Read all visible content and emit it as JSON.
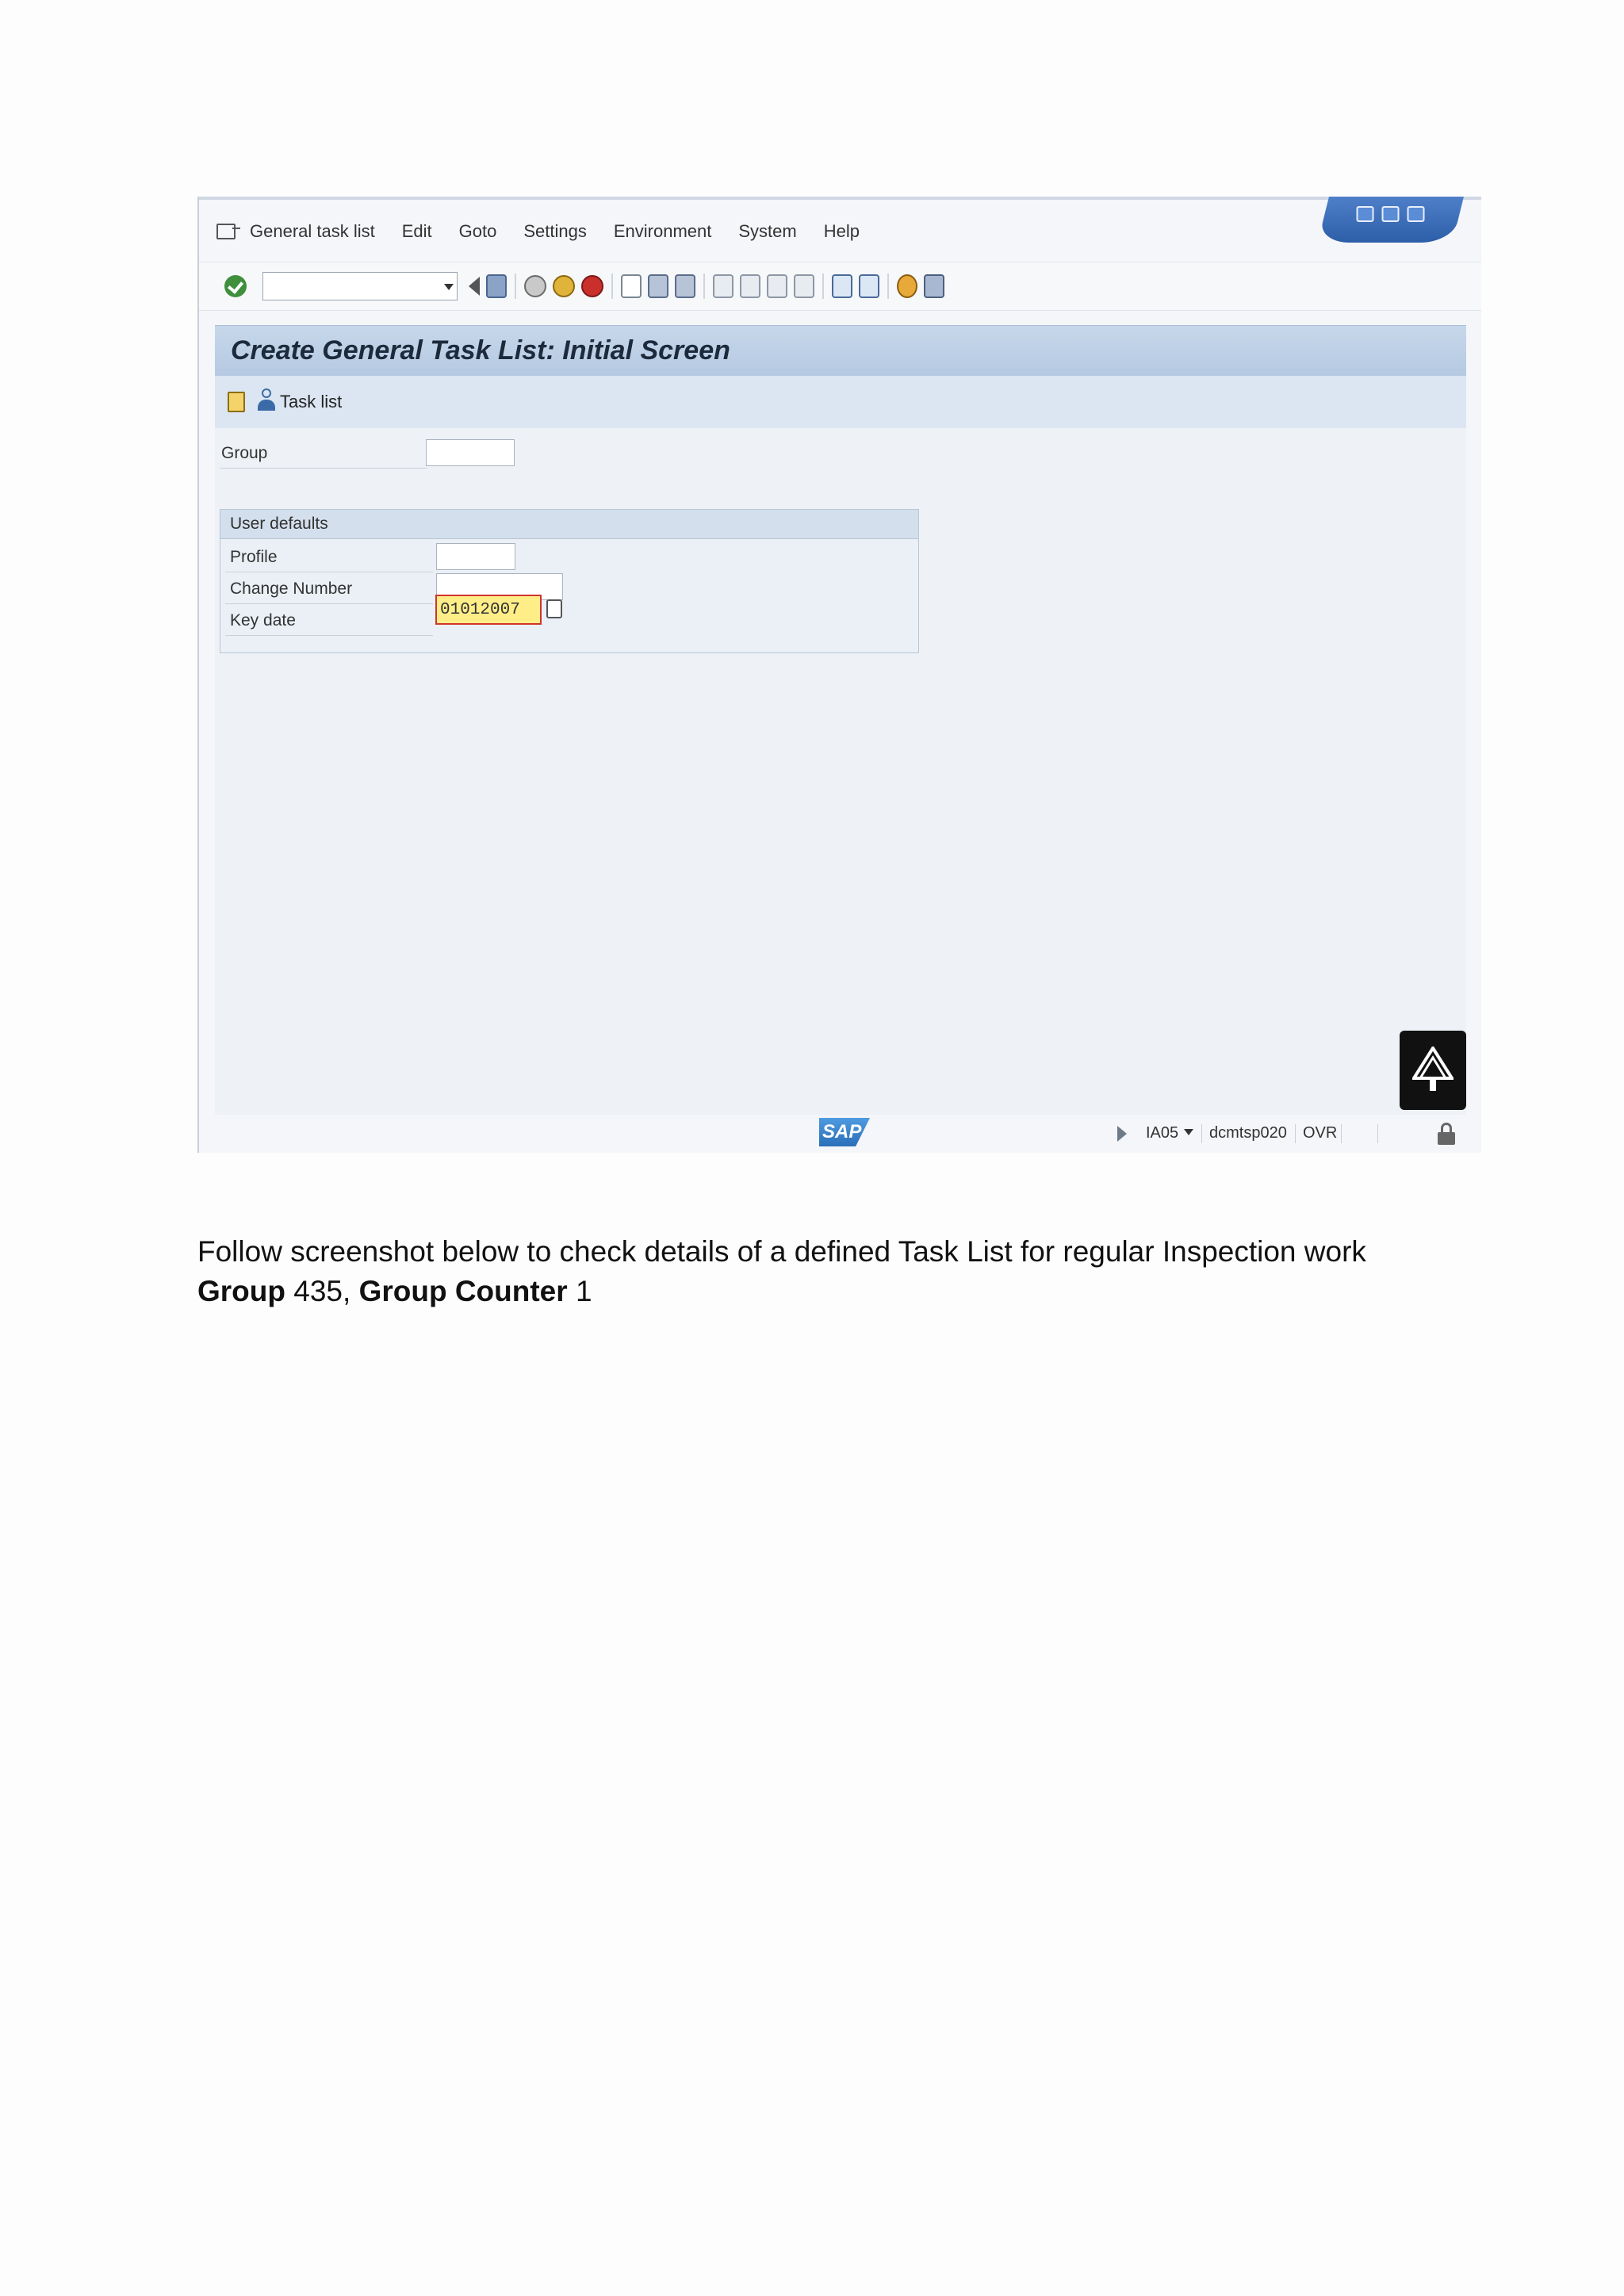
{
  "menu": [
    "General task list",
    "Edit",
    "Goto",
    "Settings",
    "Environment",
    "System",
    "Help"
  ],
  "screen": {
    "title": "Create General Task List: Initial Screen",
    "app_toolbar_label": "Task list"
  },
  "fields": {
    "group_label": "Group",
    "group_value": "",
    "user_defaults_title": "User defaults",
    "profile_label": "Profile",
    "profile_value": "",
    "change_number_label": "Change Number",
    "change_number_value": "",
    "key_date_label": "Key date",
    "key_date_value": "01012007"
  },
  "status": {
    "transaction": "IA05",
    "server": "dcmtsp020",
    "mode": "OVR",
    "logo": "SAP"
  },
  "document": {
    "line1": "Follow screenshot below to check details of a defined Task List for regular Inspection work",
    "group_label": "Group",
    "group_value": "435,",
    "group_counter_label": "Group Counter",
    "group_counter_value": "1"
  },
  "icons": [
    "menu-icon",
    "enter-check-icon",
    "back-icon",
    "save-icon",
    "back-green-icon",
    "exit-icon",
    "cancel-icon",
    "print-icon",
    "find-icon",
    "find-next-icon",
    "first-page-icon",
    "previous-page-icon",
    "next-page-icon",
    "last-page-icon",
    "new-session-icon",
    "shortcut-icon",
    "help-icon",
    "layout-icon",
    "copy-icon",
    "person-icon",
    "calendar-icon",
    "lock-icon"
  ],
  "colors": {
    "title_bar": "#b4c9e2",
    "key_date_highlight": "#ffee88",
    "error_border": "#d0342c"
  }
}
